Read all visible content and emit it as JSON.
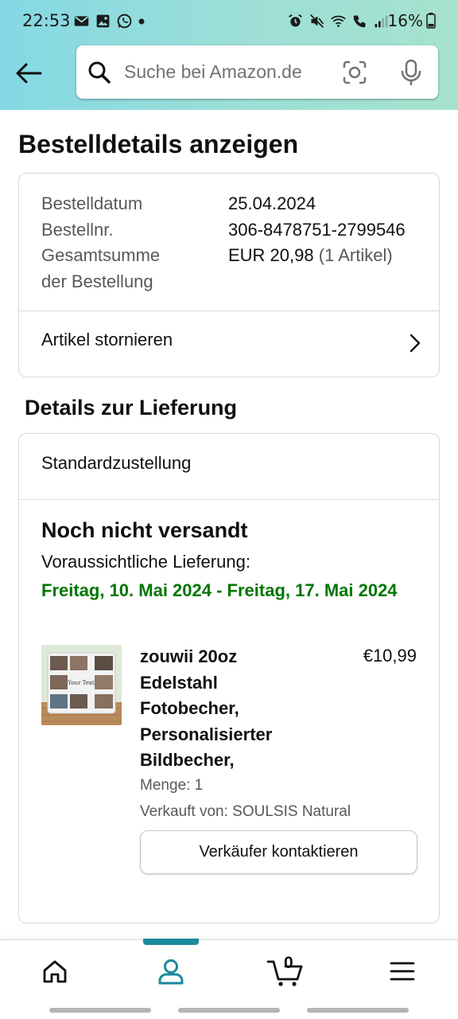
{
  "status_bar": {
    "time": "22:53",
    "battery": "16%",
    "left_icons": [
      "mail-icon",
      "image-icon",
      "whatsapp-icon",
      "dot-icon"
    ],
    "right_icons": [
      "alarm-icon",
      "mute-icon",
      "wifi-icon",
      "wifi-call-icon",
      "signal-icon"
    ]
  },
  "header": {
    "back_icon": "back-arrow-icon",
    "search_placeholder": "Suche bei Amazon.de",
    "search_icon": "search-icon",
    "camera_icon": "camera-scan-icon",
    "mic_icon": "microphone-icon",
    "background_colors": [
      "#84d8e4",
      "#a6e3cf"
    ]
  },
  "page": {
    "title": "Bestelldetails anzeigen"
  },
  "order_summary": {
    "date_label": "Bestelldatum",
    "date_value": "25.04.2024",
    "number_label": "Bestellnr.",
    "number_value": "306-8478751-2799546",
    "total_label_line1": "Gesamtsumme",
    "total_label_line2": "der Bestellung",
    "total_value": "EUR 20,98",
    "total_items": "(1 Artikel)",
    "cancel_label": "Artikel stornieren"
  },
  "delivery": {
    "section_title": "Details zur Lieferung",
    "method": "Standardzustellung",
    "status": "Noch nicht versandt",
    "eta_label": "Voraussichtliche Lieferung:",
    "eta_dates": "Freitag, 10. Mai 2024 - Freitag, 17. Mai 2024",
    "eta_color": "#007600"
  },
  "item": {
    "title": "zouwii 20oz Edelstahl Fotobecher, Personalisierter Bildbecher,",
    "price": "€10,99",
    "quantity": "Menge: 1",
    "seller": "Verkauft von: SOULSIS Natural",
    "contact_button": "Verkäufer kontaktieren",
    "thumbnail_text": "Your Text"
  },
  "bottom_nav": {
    "items": [
      "home-icon",
      "account-icon",
      "cart-icon",
      "menu-icon"
    ],
    "active": "account-icon",
    "cart_count": "0",
    "accent_color": "#1c8a9c"
  }
}
